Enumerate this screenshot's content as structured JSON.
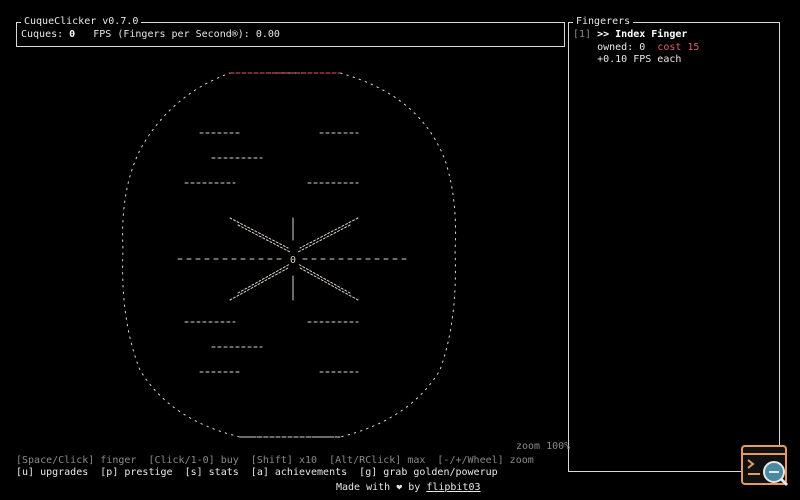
{
  "app": {
    "title": "CuqueClicker v0.7.0"
  },
  "stats": {
    "cuques_label": "Cuques: ",
    "cuques_value": "0",
    "fps_label": "   FPS (Fingers per Second®): ",
    "fps_value": "0.00"
  },
  "shop": {
    "title": "Fingerers",
    "items": [
      {
        "hotkey": "[1]",
        "marker": " >> ",
        "name": "Index Finger",
        "owned_text": "owned: 0",
        "cost_text": "cost 15",
        "rate_text": "+0.10 FPS each"
      }
    ]
  },
  "cookie": {
    "center_glyph": "0",
    "colors": {
      "outline": "#d9d9d9",
      "accent": "#e0606a",
      "pattern": "#ddd3c8"
    }
  },
  "zoom": {
    "text": "zoom 100%"
  },
  "help": {
    "line1": "[Space/Click] finger  [Click/1-0] buy  [Shift] x10  [Alt/RClick] max  [-/+/Wheel] zoom",
    "line2": "[u] upgrades  [p] prestige  [s] stats  [a] achievements  [g] grab golden/powerup"
  },
  "footer": {
    "made_with": "Made with ❤ by ",
    "author": "flipbit03"
  },
  "colors": {
    "cost": "#e0606a",
    "dim": "#8a8a8a",
    "corner_icon": "#e89a64"
  }
}
